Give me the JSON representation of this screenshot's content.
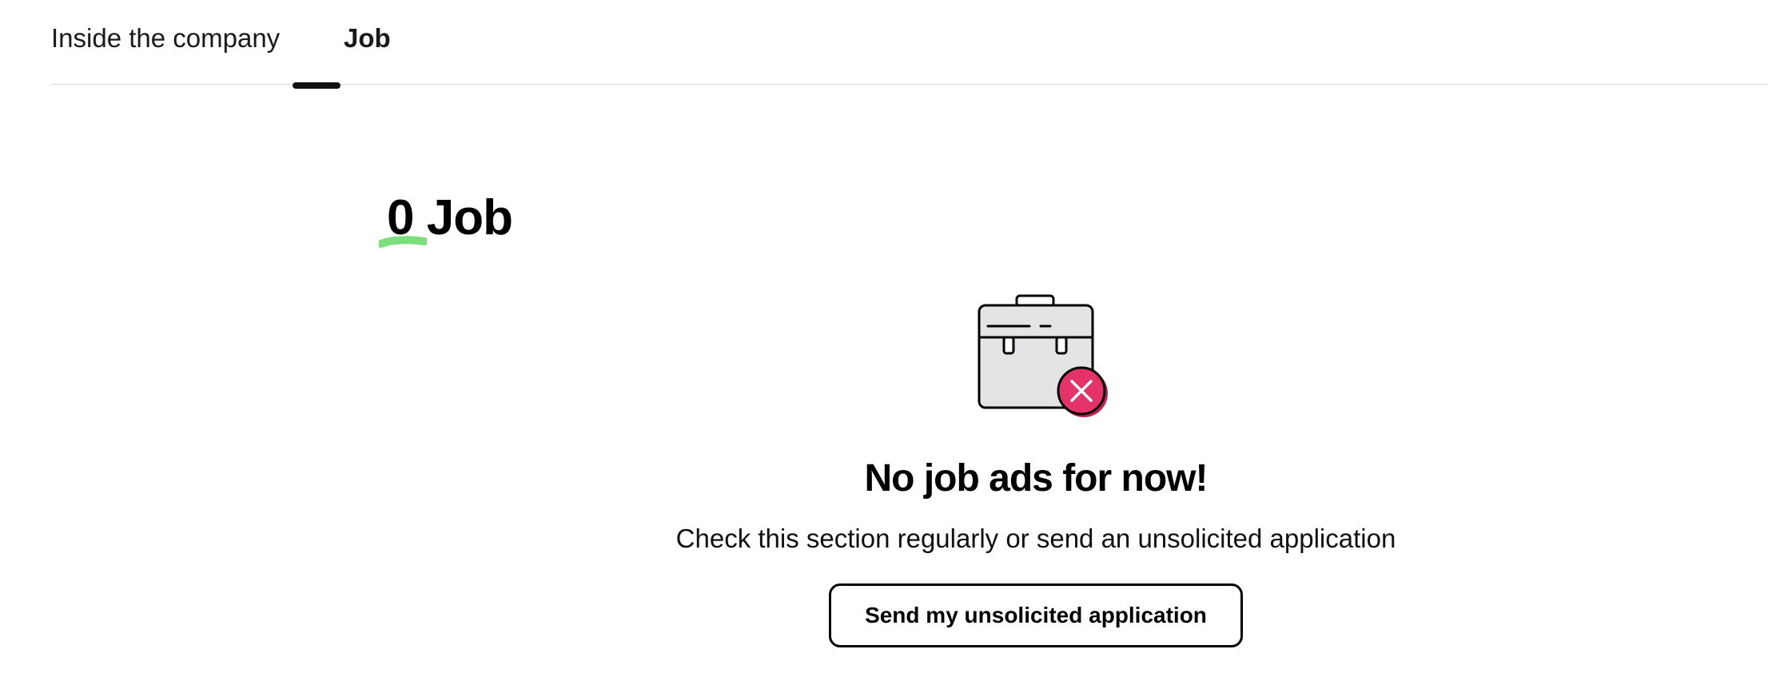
{
  "tabs": {
    "items": [
      {
        "label": "Inside the company",
        "active": false
      },
      {
        "label": "Job",
        "active": true
      }
    ]
  },
  "jobs": {
    "count": "0",
    "label": "Job",
    "highlight_color": "#7be07b"
  },
  "empty_state": {
    "icon": "briefcase-with-cross-icon",
    "badge_color": "#e5336a",
    "title": "No job ads for now!",
    "text": "Check this section regularly or send an unsolicited application",
    "button_label": "Send my unsolicited application"
  }
}
